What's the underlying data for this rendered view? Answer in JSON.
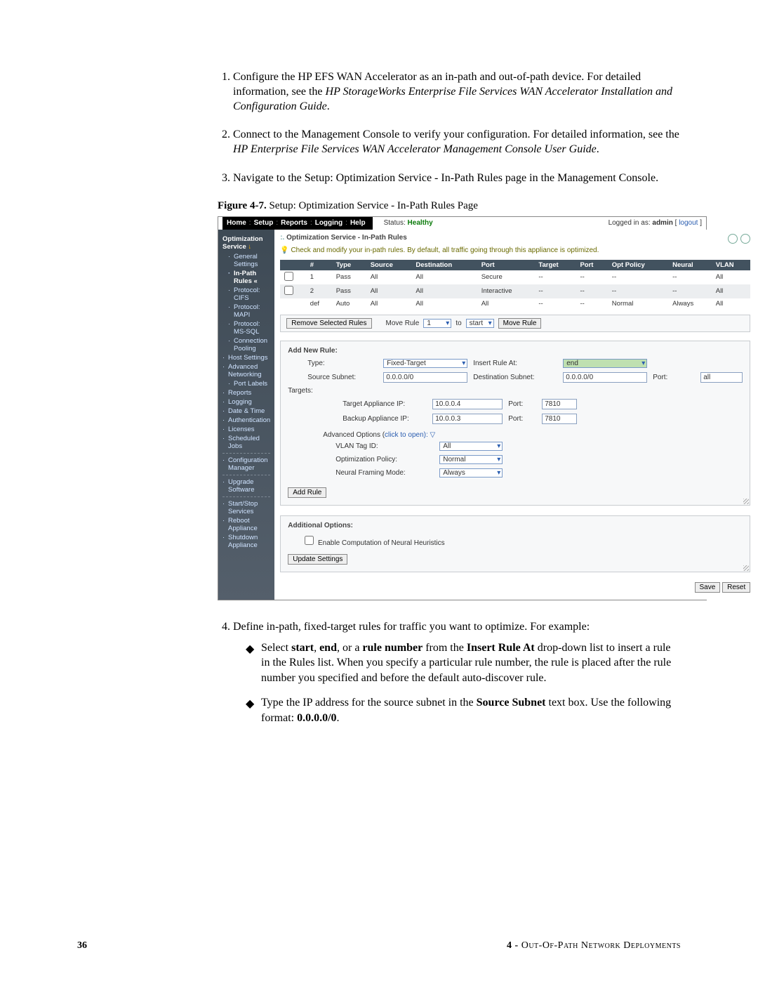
{
  "steps": {
    "s1": "Configure the HP EFS WAN Accelerator as an in-path and out-of-path device. For detailed information, see the ",
    "s1_it": "HP StorageWorks Enterprise File Services WAN Accelerator Installation and Configuration Guide",
    "s1_end": ".",
    "s2": "Connect to the Management Console to verify your configuration. For detailed information, see the ",
    "s2_it": "HP Enterprise File Services WAN Accelerator Management Console User Guide",
    "s2_end": ".",
    "s3": "Navigate to the Setup: Optimization Service - In-Path Rules page in the Management Console.",
    "s4": "Define in-path, fixed-target rules for traffic you want to optimize. For example:",
    "b1a": "Select ",
    "b1_start": "start",
    "b1_comma1": ", ",
    "b1_end": "end",
    "b1_comma2": ", or a ",
    "b1_rule": "rule number",
    "b1_from": " from the ",
    "b1_insert": "Insert Rule At",
    "b1_tail": " drop-down list to insert a rule in the Rules list. When you specify a particular rule number, the rule is placed after the rule number you specified and before the default auto-discover rule.",
    "b2a": "Type the IP address for the source subnet in the ",
    "b2_b": "Source Subnet",
    "b2_tail": " text box. Use the following format: ",
    "b2_fmt": "0.0.0.0/0",
    "b2_end": "."
  },
  "figure": {
    "caption_label": "Figure 4-7.",
    "caption_text": " Setup: Optimization Service - In-Path Rules Page",
    "topnav": {
      "home": "Home",
      "setup": "Setup",
      "reports": "Reports",
      "logging": "Logging",
      "help": "Help"
    },
    "status_label": "Status:",
    "status_value": "Healthy",
    "loggedin": "Logged in as: ",
    "user": "admin",
    "logout": "logout",
    "sidebar": {
      "hdr": "Optimization Service",
      "items": [
        {
          "label": "General Settings",
          "sub": true
        },
        {
          "label": "In-Path Rules",
          "sub": true,
          "active": true
        },
        {
          "label": "Protocol: CIFS",
          "sub": true
        },
        {
          "label": "Protocol: MAPI",
          "sub": true
        },
        {
          "label": "Protocol: MS-SQL",
          "sub": true
        },
        {
          "label": "Connection Pooling",
          "sub": true
        },
        {
          "label": "Host Settings"
        },
        {
          "label": "Advanced Networking"
        },
        {
          "label": "Port Labels",
          "sub": true
        },
        {
          "label": "Reports"
        },
        {
          "label": "Logging"
        },
        {
          "label": "Date & Time"
        },
        {
          "label": "Authentication"
        },
        {
          "label": "Licenses"
        },
        {
          "label": "Scheduled Jobs"
        },
        {
          "sep": true
        },
        {
          "label": "Configuration Manager"
        },
        {
          "sep": true
        },
        {
          "label": "Upgrade Software"
        },
        {
          "sep": true
        },
        {
          "label": "Start/Stop Services"
        },
        {
          "label": "Reboot Appliance"
        },
        {
          "label": "Shutdown Appliance"
        }
      ]
    },
    "page_title": "Optimization Service - In-Path Rules",
    "tip": "Check and modify your in-path rules. By default, all traffic going through this appliance is optimized.",
    "table": {
      "headers": [
        "#",
        "Type",
        "Source",
        "Destination",
        "Port",
        "Target",
        "Port",
        "Opt Policy",
        "Neural",
        "VLAN"
      ],
      "rows": [
        {
          "cb": true,
          "n": "1",
          "type": "Pass",
          "src": "All",
          "dst": "All",
          "port": "Secure",
          "tgt": "--",
          "tport": "--",
          "opt": "--",
          "neu": "--",
          "vlan": "All"
        },
        {
          "cb": true,
          "n": "2",
          "type": "Pass",
          "src": "All",
          "dst": "All",
          "port": "Interactive",
          "tgt": "--",
          "tport": "--",
          "opt": "--",
          "neu": "--",
          "vlan": "All",
          "alt": true
        },
        {
          "cb": false,
          "n": "def",
          "type": "Auto",
          "src": "All",
          "dst": "All",
          "port": "All",
          "tgt": "--",
          "tport": "--",
          "opt": "Normal",
          "neu": "Always",
          "vlan": "All"
        }
      ]
    },
    "toolbar": {
      "remove": "Remove Selected Rules",
      "move_label": "Move Rule",
      "move_sel": "1",
      "to": "to",
      "start_sel": "start",
      "move_btn": "Move Rule"
    },
    "newrule": {
      "hdr": "Add New Rule:",
      "type_lbl": "Type:",
      "type_val": "Fixed-Target",
      "insert_lbl": "Insert Rule At:",
      "insert_val": "end",
      "src_lbl": "Source Subnet:",
      "src_val": "0.0.0.0/0",
      "dst_lbl": "Destination Subnet:",
      "dst_val": "0.0.0.0/0",
      "port_lbl": "Port:",
      "port_val": "all",
      "targets_lbl": "Targets:",
      "tgt_ip_lbl": "Target Appliance IP:",
      "tgt_ip_val": "10.0.0.4",
      "tgt_port_lbl": "Port:",
      "tgt_port_val": "7810",
      "bkp_ip_lbl": "Backup Appliance IP:",
      "bkp_ip_val": "10.0.0.3",
      "bkp_port_lbl": "Port:",
      "bkp_port_val": "7810",
      "adv_lbl": "Advanced Options (",
      "adv_link": "click to open",
      "adv_tail": "):  ▽",
      "vlan_lbl": "VLAN Tag ID:",
      "vlan_val": "All",
      "optpol_lbl": "Optimization Policy:",
      "optpol_val": "Normal",
      "neu_lbl": "Neural Framing Mode:",
      "neu_val": "Always",
      "add_btn": "Add Rule"
    },
    "additional": {
      "hdr": "Additional Options:",
      "cb_lbl": "Enable Computation of Neural Heuristics",
      "update": "Update Settings"
    },
    "save": "Save",
    "reset": "Reset"
  },
  "footer": {
    "page": "36",
    "chapter_num": "4 - ",
    "chapter": "Out-Of-Path Network Deployments"
  }
}
